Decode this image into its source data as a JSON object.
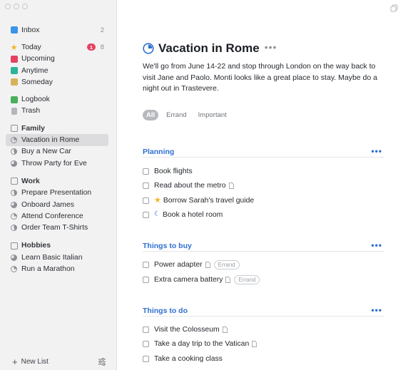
{
  "sidebar": {
    "items": [
      {
        "key": "inbox",
        "label": "Inbox",
        "count": "2",
        "icon": "inbox-icon"
      },
      {
        "key": "today",
        "label": "Today",
        "badge": "1",
        "count": "8",
        "icon": "star-icon"
      },
      {
        "key": "upcoming",
        "label": "Upcoming",
        "icon": "calendar-icon"
      },
      {
        "key": "anytime",
        "label": "Anytime",
        "icon": "layers-icon"
      },
      {
        "key": "someday",
        "label": "Someday",
        "icon": "archive-box-icon"
      },
      {
        "key": "logbook",
        "label": "Logbook",
        "icon": "logbook-icon"
      },
      {
        "key": "trash",
        "label": "Trash",
        "icon": "trash-icon"
      }
    ],
    "areas": [
      {
        "label": "Family",
        "projects": [
          "Vacation in Rome",
          "Buy a New Car",
          "Throw Party for Eve"
        ]
      },
      {
        "label": "Work",
        "projects": [
          "Prepare Presentation",
          "Onboard James",
          "Attend Conference",
          "Order Team T-Shirts"
        ]
      },
      {
        "label": "Hobbies",
        "projects": [
          "Learn Basic Italian",
          "Run a Marathon"
        ]
      }
    ],
    "selected": "Vacation in Rome",
    "new_list_label": "New List"
  },
  "main": {
    "title": "Vacation in Rome",
    "more": "•••",
    "notes": "We'll go from June 14-22 and stop through London on the way back to visit Jane and Paolo. Monti looks like a great place to stay. Maybe do a night out in Trastevere.",
    "tags": [
      "All",
      "Errand",
      "Important"
    ],
    "headings": [
      {
        "label": "Planning",
        "more": "•••",
        "todos": [
          {
            "label": "Book flights"
          },
          {
            "label": "Read about the metro",
            "note": true
          },
          {
            "label": "Borrow Sarah's travel guide",
            "star": true
          },
          {
            "label": "Book a hotel room",
            "evening": true
          }
        ]
      },
      {
        "label": "Things to buy",
        "more": "•••",
        "todos": [
          {
            "label": "Power adapter",
            "note": true,
            "tag": "Errand"
          },
          {
            "label": "Extra camera battery",
            "note": true,
            "tag": "Errand"
          }
        ]
      },
      {
        "label": "Things to do",
        "more": "•••",
        "todos": [
          {
            "label": "Visit the Colosseum",
            "note": true
          },
          {
            "label": "Take a day trip to the Vatican",
            "note": true
          },
          {
            "label": "Take a cooking class"
          }
        ]
      }
    ]
  },
  "colors": {
    "accent": "#2f6fd1",
    "badge": "#e5415f",
    "star": "#f3b71c",
    "inbox": "#3a95e8",
    "upcoming": "#e5415f",
    "anytime": "#2bb39a",
    "someday": "#d6b35a"
  }
}
